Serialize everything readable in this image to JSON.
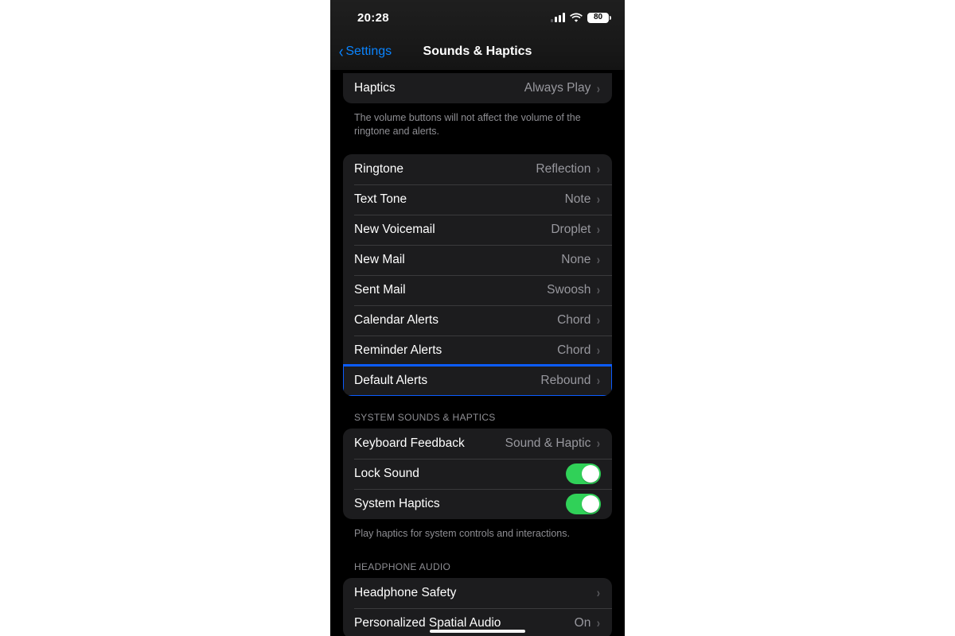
{
  "status": {
    "time": "20:28",
    "battery_percent": "80"
  },
  "nav": {
    "back_label": "Settings",
    "title": "Sounds & Haptics"
  },
  "haptics_row": {
    "label": "Haptics",
    "value": "Always Play"
  },
  "volume_footer": "The volume buttons will not affect the volume of the ringtone and alerts.",
  "sound_rows": {
    "ringtone": {
      "label": "Ringtone",
      "value": "Reflection"
    },
    "text_tone": {
      "label": "Text Tone",
      "value": "Note"
    },
    "new_voicemail": {
      "label": "New Voicemail",
      "value": "Droplet"
    },
    "new_mail": {
      "label": "New Mail",
      "value": "None"
    },
    "sent_mail": {
      "label": "Sent Mail",
      "value": "Swoosh"
    },
    "calendar_alerts": {
      "label": "Calendar Alerts",
      "value": "Chord"
    },
    "reminder_alerts": {
      "label": "Reminder Alerts",
      "value": "Chord"
    },
    "default_alerts": {
      "label": "Default Alerts",
      "value": "Rebound"
    }
  },
  "section_system_header": "SYSTEM SOUNDS & HAPTICS",
  "system_rows": {
    "keyboard_feedback": {
      "label": "Keyboard Feedback",
      "value": "Sound & Haptic"
    },
    "lock_sound": {
      "label": "Lock Sound",
      "on": true
    },
    "system_haptics": {
      "label": "System Haptics",
      "on": true
    }
  },
  "system_footer": "Play haptics for system controls and interactions.",
  "section_headphone_header": "HEADPHONE AUDIO",
  "headphone_rows": {
    "headphone_safety": {
      "label": "Headphone Safety",
      "value": ""
    },
    "spatial_audio": {
      "label": "Personalized Spatial Audio",
      "value": "On"
    }
  },
  "colors": {
    "accent_blue": "#0a84ff",
    "highlight_blue": "#0b5cff",
    "toggle_green": "#30d158",
    "cell_bg": "#1c1c1e",
    "secondary_text": "#98989e"
  }
}
